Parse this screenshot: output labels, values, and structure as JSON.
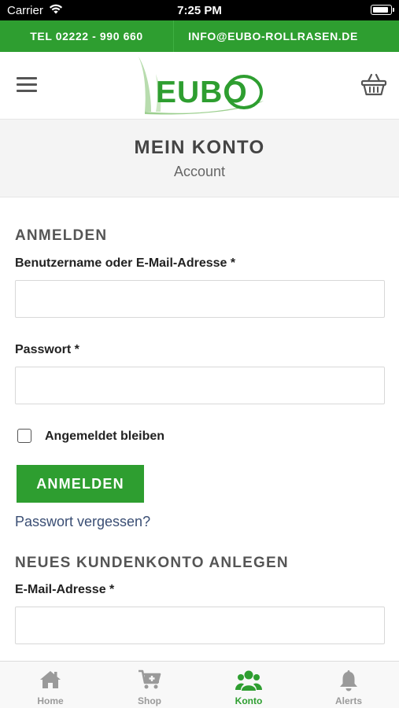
{
  "status_bar": {
    "carrier": "Carrier",
    "time": "7:25 PM"
  },
  "contact_bar": {
    "phone": "TEL 02222 - 990 660",
    "email": "INFO@EUBO-ROLLRASEN.DE"
  },
  "header": {
    "logo_text": "EUBO",
    "menu_icon": "hamburger-menu-icon",
    "cart_icon": "basket-icon"
  },
  "page": {
    "title": "MEIN KONTO",
    "subtitle": "Account"
  },
  "login": {
    "heading": "ANMELDEN",
    "username_label": "Benutzername oder E-Mail-Adresse *",
    "username_value": "",
    "password_label": "Passwort *",
    "password_value": "",
    "remember_label": "Angemeldet bleiben",
    "remember_checked": false,
    "submit_label": "ANMELDEN",
    "forgot_link": "Passwort vergessen?"
  },
  "register": {
    "heading": "NEUES KUNDENKONTO ANLEGEN",
    "email_label": "E-Mail-Adresse *",
    "email_value": ""
  },
  "tab_bar": {
    "items": [
      {
        "label": "Home",
        "icon": "home-icon",
        "active": false
      },
      {
        "label": "Shop",
        "icon": "cart-plus-icon",
        "active": false
      },
      {
        "label": "Konto",
        "icon": "users-icon",
        "active": true
      },
      {
        "label": "Alerts",
        "icon": "bell-icon",
        "active": false
      }
    ]
  },
  "colors": {
    "brand_green": "#2e9e30",
    "link_blue": "#3a4e74",
    "inactive_tab": "#9a9a9a"
  }
}
